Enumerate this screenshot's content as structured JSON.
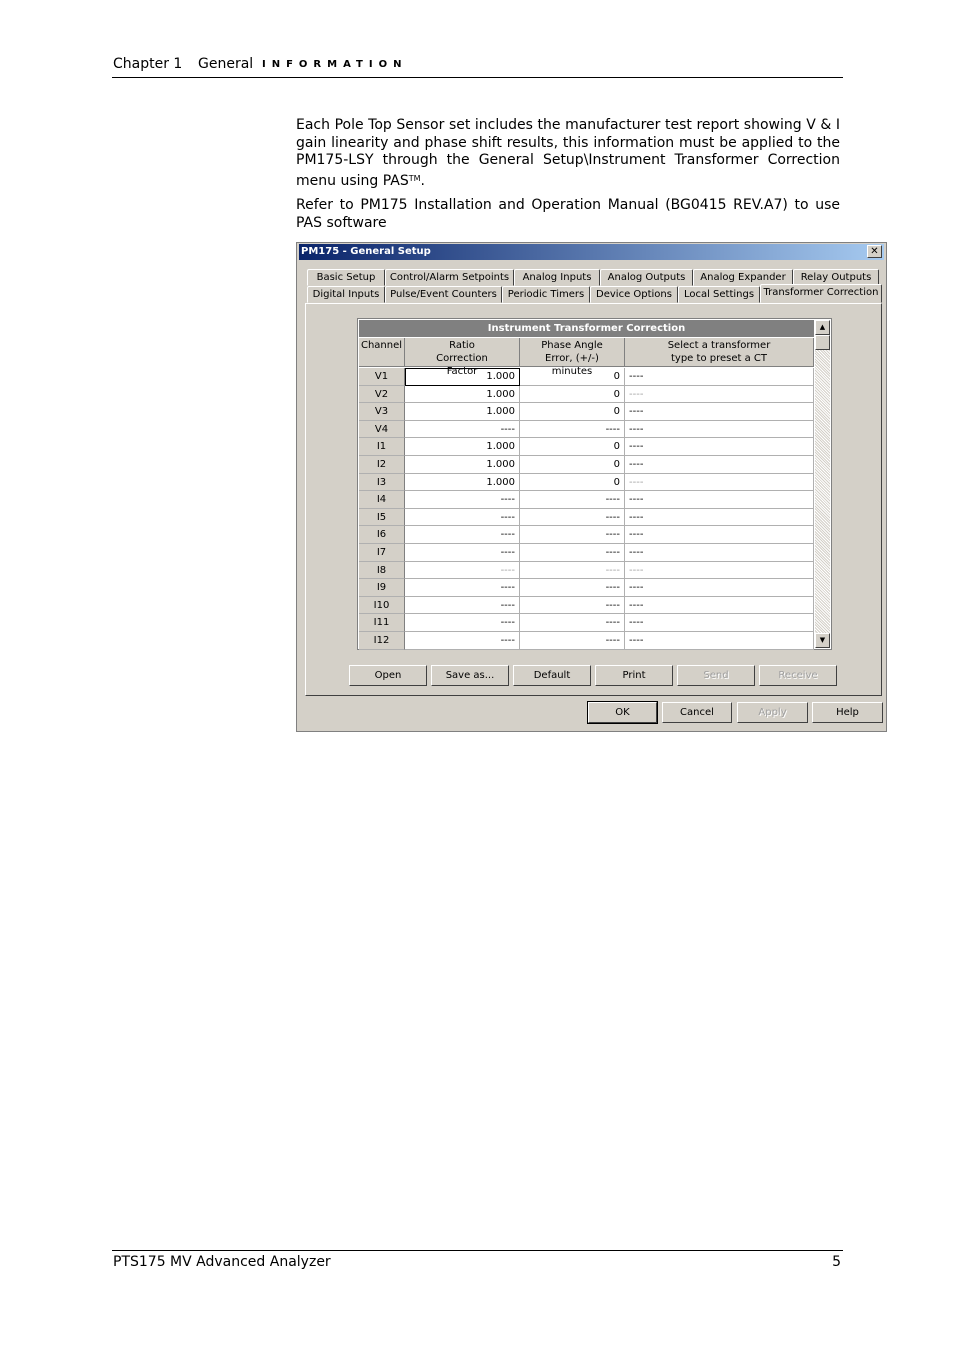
{
  "header": {
    "chapter": "Chapter 1",
    "section": "General",
    "information": "INFORMATION"
  },
  "paragraphs": {
    "p1": "Each Pole Top Sensor set includes the manufacturer test report showing V & I gain linearity and phase shift results, this information must be applied to the PM175-LSY through the General Setup\\Instrument Transformer Correction menu using PAS",
    "p1_tm": "TM",
    "p1_end": ".",
    "p2": "Refer to PM175 Installation and Operation Manual (BG0415 REV.A7) to use PAS software"
  },
  "dialog": {
    "title": "PM175 - General Setup",
    "close": "✕",
    "tabs_row1": [
      "Basic Setup",
      "Control/Alarm Setpoints",
      "Analog Inputs",
      "Analog Outputs",
      "Analog Expander",
      "Relay Outputs"
    ],
    "tabs_row2": [
      "Digital Inputs",
      "Pulse/Event Counters",
      "Periodic Timers",
      "Device Options",
      "Local Settings",
      "Transformer Correction"
    ],
    "grid": {
      "title": "Instrument Transformer Correction",
      "headers": [
        "Channel",
        "Ratio Correction Factor",
        "Phase Angle Error, (+/-) minutes",
        "Select a transformer type to preset a CT"
      ],
      "rows": [
        [
          "V1",
          "1.000",
          "0",
          "----"
        ],
        [
          "V2",
          "1.000",
          "0",
          "----"
        ],
        [
          "V3",
          "1.000",
          "0",
          "----"
        ],
        [
          "V4",
          "----",
          "----",
          "----"
        ],
        [
          "I1",
          "1.000",
          "0",
          "----"
        ],
        [
          "I2",
          "1.000",
          "0",
          "----"
        ],
        [
          "I3",
          "1.000",
          "0",
          "----"
        ],
        [
          "I4",
          "----",
          "----",
          "----"
        ],
        [
          "I5",
          "----",
          "----",
          "----"
        ],
        [
          "I6",
          "----",
          "----",
          "----"
        ],
        [
          "I7",
          "----",
          "----",
          "----"
        ],
        [
          "I8",
          "----",
          "----",
          "----"
        ],
        [
          "I9",
          "----",
          "----",
          "----"
        ],
        [
          "I10",
          "----",
          "----",
          "----"
        ],
        [
          "I11",
          "----",
          "----",
          "----"
        ],
        [
          "I12",
          "----",
          "----",
          "----"
        ]
      ]
    },
    "buttons": {
      "open": "Open",
      "save_as": "Save as...",
      "default": "Default",
      "print": "Print",
      "send": "Send",
      "receive": "Receive",
      "ok": "OK",
      "cancel": "Cancel",
      "apply": "Apply",
      "help": "Help"
    }
  },
  "footer": {
    "title": "PTS175 MV Advanced Analyzer",
    "page": "5"
  }
}
